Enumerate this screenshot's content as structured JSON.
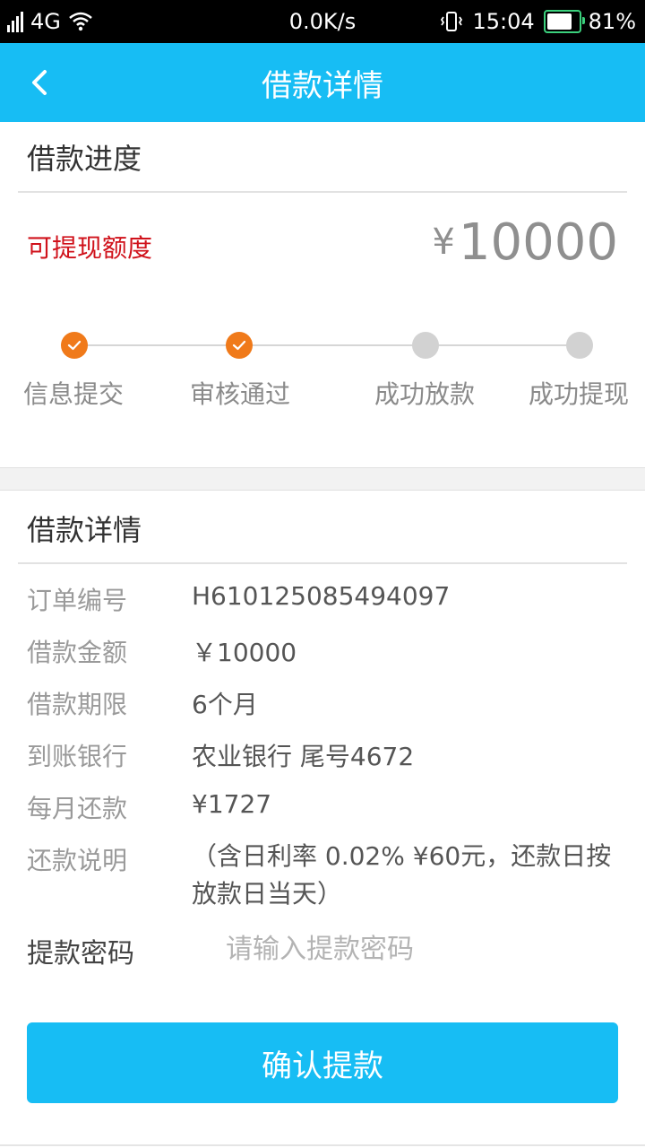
{
  "status_bar": {
    "network": "4G",
    "speed": "0.0K/s",
    "time": "15:04",
    "battery": "81%"
  },
  "header": {
    "title": "借款详情",
    "back_icon": "chevron-left-icon"
  },
  "progress": {
    "section_title": "借款进度",
    "limit_label": "可提现额度",
    "limit_currency": "¥",
    "limit_amount": "10000",
    "steps": [
      {
        "label": "信息提交",
        "done": true
      },
      {
        "label": "审核通过",
        "done": true
      },
      {
        "label": "成功放款",
        "done": false
      },
      {
        "label": "成功提现",
        "done": false
      }
    ]
  },
  "details": {
    "section_title": "借款详情",
    "rows": [
      {
        "label": "订单编号",
        "value": "H610125085494097"
      },
      {
        "label": "借款金额",
        "value": "￥10000"
      },
      {
        "label": "借款期限",
        "value": "6个月"
      },
      {
        "label": "到账银行",
        "value": "农业银行 尾号4672"
      },
      {
        "label": "每月还款",
        "value": "¥1727"
      },
      {
        "label": "还款说明",
        "value": "（含日利率 0.02% ¥60元，还款日按放款日当天）"
      }
    ]
  },
  "password": {
    "label": "提款密码",
    "placeholder": "请输入提款密码",
    "value": ""
  },
  "confirm": {
    "label": "确认提款"
  },
  "colors": {
    "primary": "#17bdf4",
    "step_done": "#f07a1a",
    "step_todo": "#d2d2d2",
    "limit_label": "#d0121b"
  }
}
